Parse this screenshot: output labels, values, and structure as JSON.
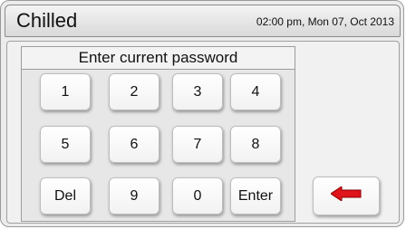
{
  "header": {
    "title": "Chilled",
    "datetime": "02:00 pm, Mon 07, Oct 2013"
  },
  "keypad": {
    "prompt": "Enter current password",
    "keys": [
      "1",
      "2",
      "3",
      "4",
      "5",
      "6",
      "7",
      "8",
      "Del",
      "9",
      "0",
      "Enter"
    ]
  },
  "back_button": {
    "icon": "left-arrow-icon",
    "color": "#e0141b"
  }
}
